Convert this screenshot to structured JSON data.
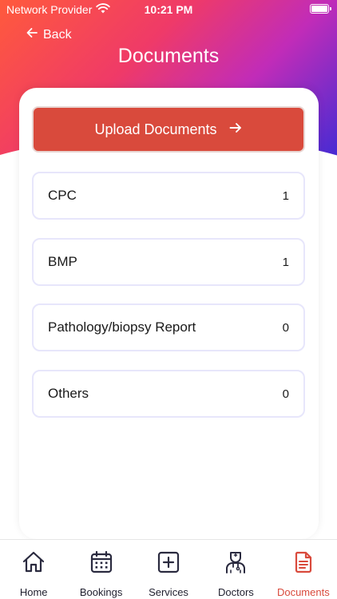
{
  "status_bar": {
    "carrier": "Network Provider",
    "time": "10:21 PM"
  },
  "header": {
    "back_label": "Back",
    "title": "Documents"
  },
  "upload_button": {
    "label": "Upload Documents"
  },
  "documents": [
    {
      "label": "CPC",
      "count": "1"
    },
    {
      "label": "BMP",
      "count": "1"
    },
    {
      "label": "Pathology/biopsy Report",
      "count": "0"
    },
    {
      "label": "Others",
      "count": "0"
    }
  ],
  "tabs": [
    {
      "label": "Home",
      "icon": "home-icon"
    },
    {
      "label": "Bookings",
      "icon": "calendar-icon"
    },
    {
      "label": "Services",
      "icon": "plus-square-icon"
    },
    {
      "label": "Doctors",
      "icon": "doctor-icon"
    },
    {
      "label": "Documents",
      "icon": "document-icon",
      "active": true
    }
  ],
  "colors": {
    "accent": "#d94a3c",
    "row_border": "#e7e6fb",
    "gradient_start": "#ff5a3c",
    "gradient_end": "#3a2bd6"
  }
}
